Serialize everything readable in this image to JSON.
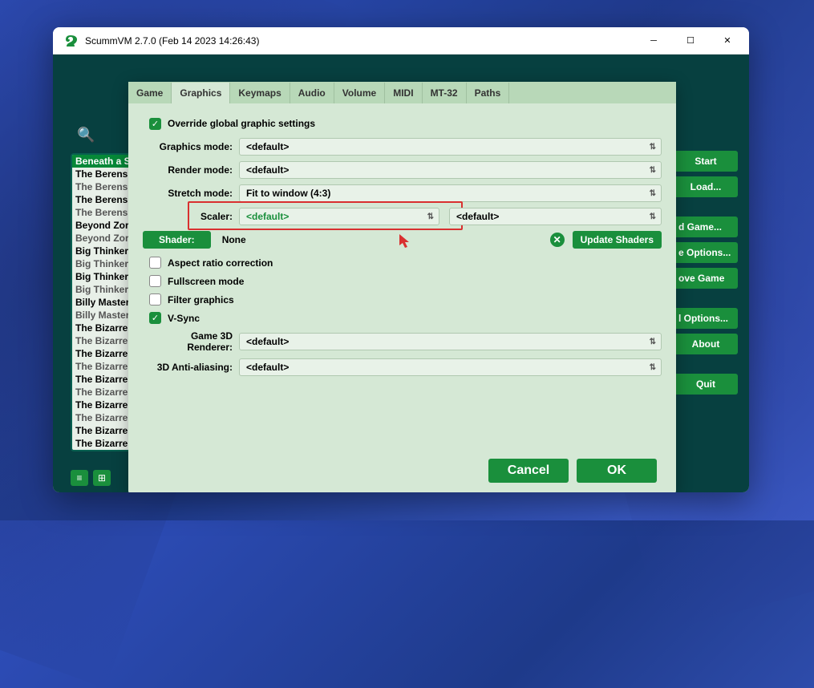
{
  "window": {
    "title": "ScummVM 2.7.0 (Feb 14 2023 14:26:43)"
  },
  "games": [
    {
      "label": "Beneath a S",
      "sel": true
    },
    {
      "label": "The Berens"
    },
    {
      "label": "The Berens",
      "dim": true
    },
    {
      "label": "The Berens"
    },
    {
      "label": "The Berens",
      "dim": true
    },
    {
      "label": "Beyond Zor"
    },
    {
      "label": "Beyond Zor",
      "dim": true
    },
    {
      "label": "Big Thinker"
    },
    {
      "label": "Big Thinker",
      "dim": true
    },
    {
      "label": "Big Thinker"
    },
    {
      "label": "Big Thinker",
      "dim": true
    },
    {
      "label": "Billy Master"
    },
    {
      "label": "Billy Master",
      "dim": true
    },
    {
      "label": "The Bizarre"
    },
    {
      "label": "The Bizarre",
      "dim": true
    },
    {
      "label": "The Bizarre"
    },
    {
      "label": "The Bizarre",
      "dim": true
    },
    {
      "label": "The Bizarre"
    },
    {
      "label": "The Bizarre",
      "dim": true
    },
    {
      "label": "The Bizarre"
    },
    {
      "label": "The Bizarre",
      "dim": true
    },
    {
      "label": "The Bizarre"
    },
    {
      "label": "The Bizarre"
    }
  ],
  "sideButtons": {
    "start": "Start",
    "load": "Load...",
    "addGame": "d Game...",
    "options": "e Options...",
    "remove": "ove Game",
    "globalOpts": "l Options...",
    "about": "About",
    "quit": "Quit"
  },
  "tabs": [
    "Game",
    "Graphics",
    "Keymaps",
    "Audio",
    "Volume",
    "MIDI",
    "MT-32",
    "Paths"
  ],
  "activeTab": 1,
  "settings": {
    "overrideLabel": "Override global graphic settings",
    "overrideChecked": true,
    "labels": {
      "graphicsMode": "Graphics mode:",
      "renderMode": "Render mode:",
      "stretchMode": "Stretch mode:",
      "scaler": "Scaler:",
      "shader": "Shader:",
      "game3d": "Game 3D Renderer:",
      "aa": "3D Anti-aliasing:"
    },
    "values": {
      "graphicsMode": "<default>",
      "renderMode": "<default>",
      "stretchMode": "Fit to window (4:3)",
      "scaler": "<default>",
      "scaler2": "<default>",
      "shaderValue": "None",
      "game3d": "<default>",
      "aa": "<default>"
    },
    "updateShaders": "Update Shaders",
    "checkboxes": {
      "aspect": {
        "label": "Aspect ratio correction",
        "checked": false
      },
      "fullscreen": {
        "label": "Fullscreen mode",
        "checked": false
      },
      "filter": {
        "label": "Filter graphics",
        "checked": false
      },
      "vsync": {
        "label": "V-Sync",
        "checked": true
      }
    }
  },
  "dialogButtons": {
    "cancel": "Cancel",
    "ok": "OK"
  }
}
